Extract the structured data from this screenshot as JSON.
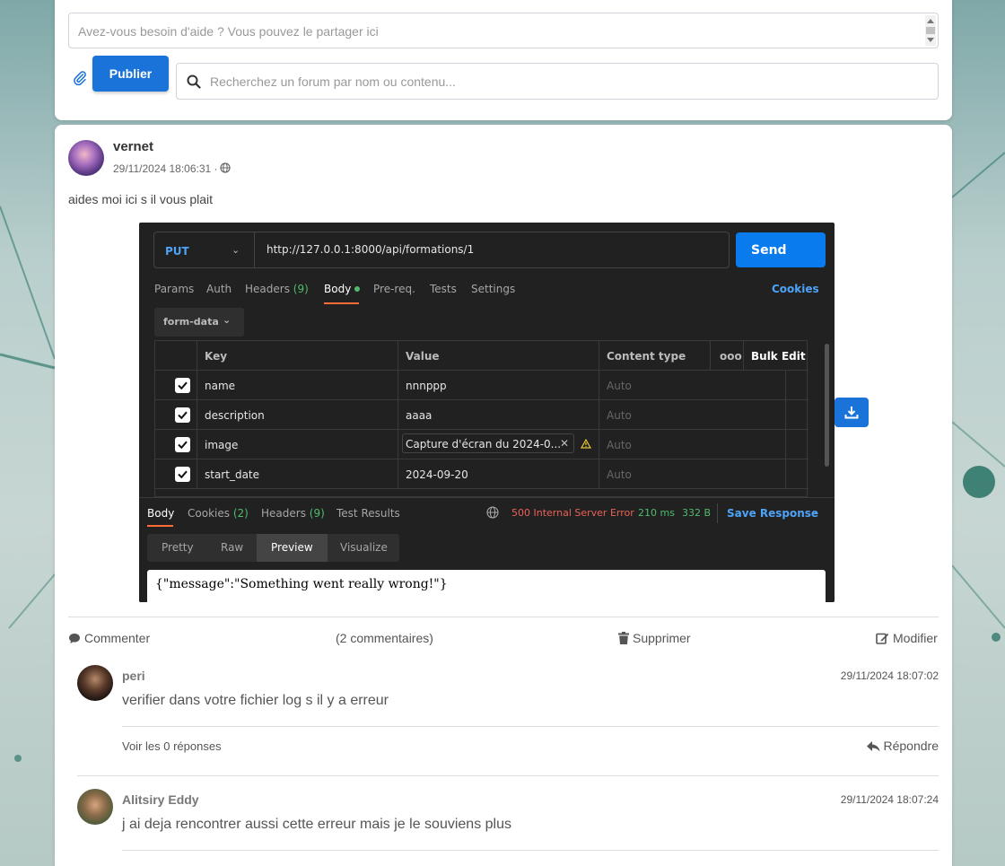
{
  "composer": {
    "help_placeholder": "Avez-vous besoin d'aide ? Vous pouvez le partager ici",
    "publish_label": "Publier",
    "search_placeholder": "Recherchez un forum par nom ou contenu..."
  },
  "post": {
    "author": "vernet",
    "date": "29/11/2024 18:06:31 ·",
    "text": "aides moi ici s il vous plait",
    "screenshot": {
      "method": "PUT",
      "url": "http://127.0.0.1:8000/api/formations/1",
      "send_label": "Send",
      "tabs": [
        {
          "label": "Params"
        },
        {
          "label": "Auth"
        },
        {
          "label": "Headers",
          "count": "(9)"
        },
        {
          "label": "Body"
        },
        {
          "label": "Pre-req."
        },
        {
          "label": "Tests"
        },
        {
          "label": "Settings"
        }
      ],
      "cookies_label": "Cookies",
      "body_type": "form-data",
      "table_headers": {
        "key": "Key",
        "value": "Value",
        "content_type": "Content type",
        "more": "ooo",
        "bulk_edit": "Bulk Edit"
      },
      "rows": [
        {
          "key": "name",
          "value": "nnnppp",
          "content_type": "Auto"
        },
        {
          "key": "description",
          "value": "aaaa",
          "content_type": "Auto"
        },
        {
          "key": "image",
          "value": "Capture d'écran du 2024-0...",
          "content_type": "Auto"
        },
        {
          "key": "start_date",
          "value": "2024-09-20",
          "content_type": "Auto"
        }
      ],
      "response_tabs": [
        {
          "label": "Body"
        },
        {
          "label": "Cookies",
          "count": "(2)"
        },
        {
          "label": "Headers",
          "count": "(9)"
        },
        {
          "label": "Test Results"
        }
      ],
      "status": "500 Internal Server Error",
      "time": "210 ms",
      "size": "332 B",
      "save_response": "Save Response",
      "view_tabs": [
        "Pretty",
        "Raw",
        "Preview",
        "Visualize"
      ],
      "response_body": "{\"message\":\"Something went really wrong!\"}",
      "colors": {
        "status_error": "#e86156",
        "ok_green": "#4fbc6c",
        "accent_blue": "#4ea3f7",
        "send_blue": "#097bed"
      }
    },
    "actions": {
      "comment": "Commenter",
      "comment_count": "(2 commentaires)",
      "delete": "Supprimer",
      "edit": "Modifier"
    }
  },
  "comments": [
    {
      "author": "peri",
      "date": "29/11/2024 18:07:02",
      "text": "verifier dans votre fichier log s il y a erreur",
      "replies": "Voir les 0 réponses",
      "reply_label": "Répondre"
    },
    {
      "author": "Alitsiry Eddy",
      "date": "29/11/2024 18:07:24",
      "text": "j ai deja rencontrer aussi cette erreur mais je le souviens plus"
    }
  ],
  "colors": {
    "primary": "#1a73d9"
  }
}
